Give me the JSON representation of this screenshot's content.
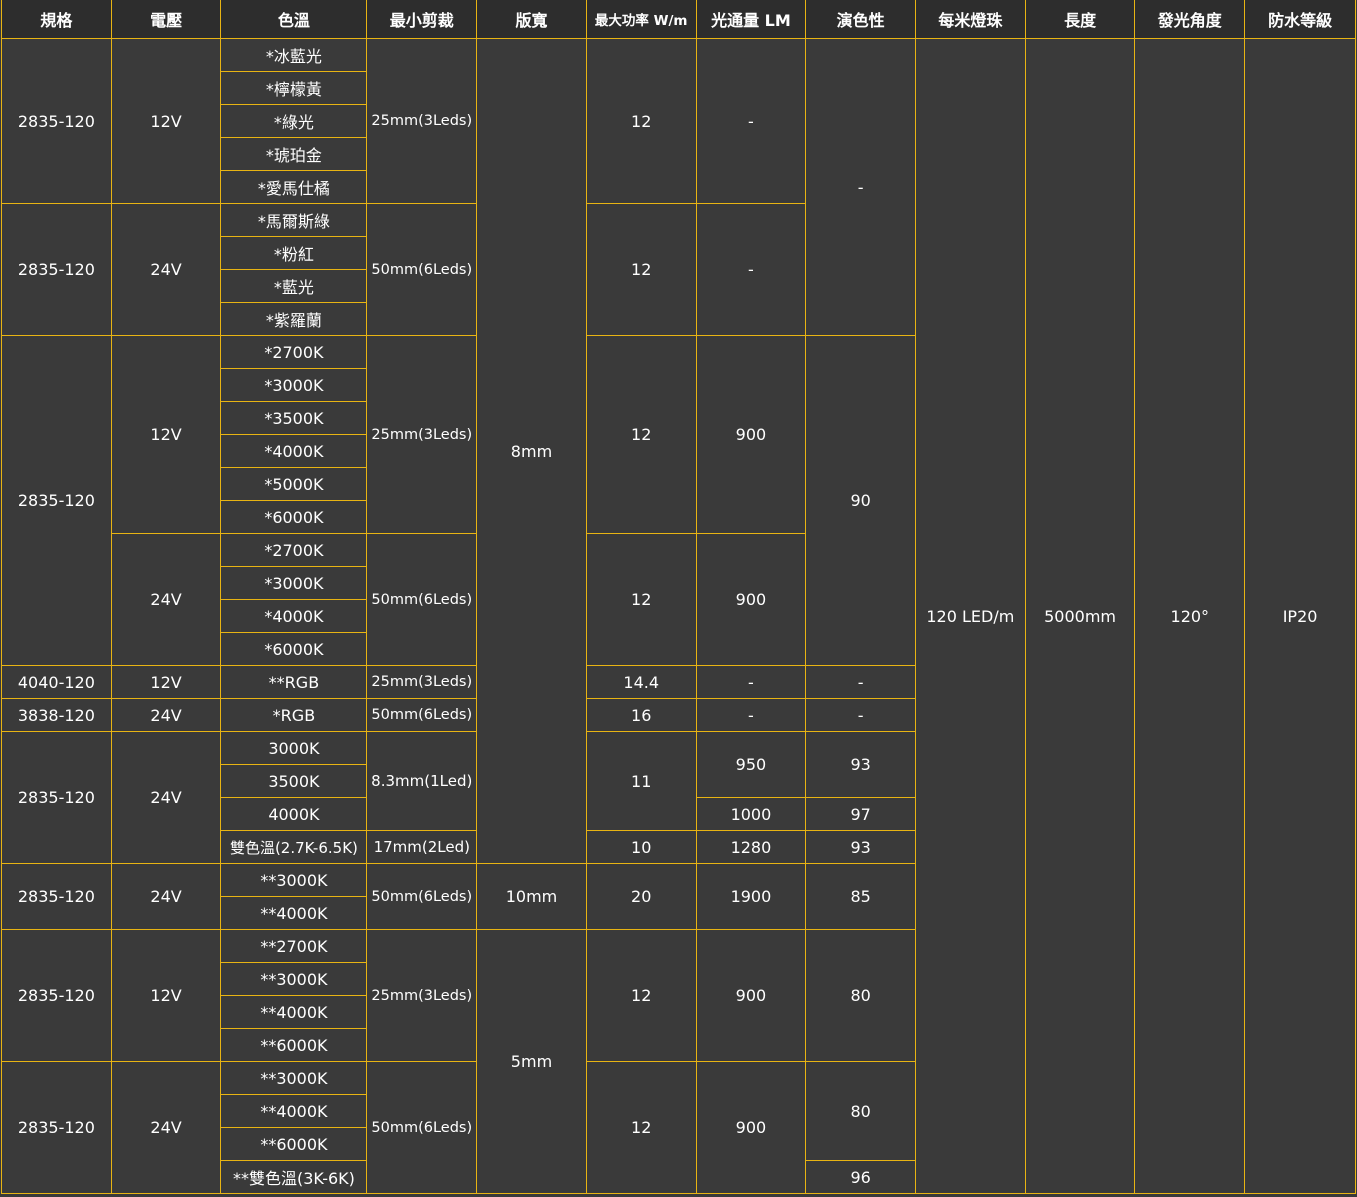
{
  "headers": {
    "spec": "規格",
    "voltage": "電壓",
    "color_temp": "色溫",
    "min_cut": "最小剪裁",
    "board_width": "版寬",
    "max_power": "最大功率 W/m",
    "luminous_flux": "光通量 LM",
    "cri": "演色性",
    "leds_per_meter": "每米燈珠",
    "length": "長度",
    "beam_angle": "發光角度",
    "ip_rating": "防水等級"
  },
  "shared": {
    "leds_per_meter": "120 LED/m",
    "length": "5000mm",
    "beam_angle": "120°",
    "ip_rating": "IP20"
  },
  "groups": {
    "g1": {
      "spec": "2835-120",
      "voltage": "12V",
      "min_cut": "25mm(3Leds)",
      "power": "12",
      "lm": "-",
      "colors": [
        "*冰藍光",
        "*檸檬黃",
        "*綠光",
        "*琥珀金",
        "*愛馬仕橘"
      ]
    },
    "g2": {
      "spec": "2835-120",
      "voltage": "24V",
      "min_cut": "50mm(6Leds)",
      "power": "12",
      "lm": "-",
      "colors": [
        "*馬爾斯綠",
        "*粉紅",
        "*藍光",
        "*紫羅蘭"
      ]
    },
    "cri_g12": "-",
    "g3": {
      "spec": "2835-120",
      "cri": "90",
      "a": {
        "voltage": "12V",
        "min_cut": "25mm(3Leds)",
        "power": "12",
        "lm": "900",
        "colors": [
          "*2700K",
          "*3000K",
          "*3500K",
          "*4000K",
          "*5000K",
          "*6000K"
        ]
      },
      "b": {
        "voltage": "24V",
        "min_cut": "50mm(6Leds)",
        "power": "12",
        "lm": "900",
        "colors": [
          "*2700K",
          "*3000K",
          "*4000K",
          "*6000K"
        ]
      }
    },
    "g4": {
      "spec": "4040-120",
      "voltage": "12V",
      "color": "**RGB",
      "min_cut": "25mm(3Leds)",
      "power": "14.4",
      "lm": "-",
      "cri": "-"
    },
    "g5": {
      "spec": "3838-120",
      "voltage": "24V",
      "color": "*RGB",
      "min_cut": "50mm(6Leds)",
      "power": "16",
      "lm": "-",
      "cri": "-"
    },
    "board_8mm": "8mm",
    "g6": {
      "spec": "2835-120",
      "voltage": "24V",
      "colors": [
        "3000K",
        "3500K",
        "4000K",
        "雙色溫(2.7K-6.5K)"
      ],
      "min_cut_a": "8.3mm(1Led)",
      "min_cut_b": "17mm(2Led)",
      "power_a": "11",
      "power_b": "10",
      "lm": [
        "950",
        "1000",
        "1280"
      ],
      "cri": [
        "93",
        "97",
        "93"
      ]
    },
    "g7": {
      "spec": "2835-120",
      "voltage": "24V",
      "colors": [
        "**3000K",
        "**4000K"
      ],
      "min_cut": "50mm(6Leds)",
      "board": "10mm",
      "power": "20",
      "lm": "1900",
      "cri": "85"
    },
    "g8": {
      "spec": "2835-120",
      "voltage": "12V",
      "colors": [
        "**2700K",
        "**3000K",
        "**4000K",
        "**6000K"
      ],
      "min_cut": "25mm(3Leds)",
      "power": "12",
      "lm": "900",
      "cri": "80"
    },
    "board_5mm": "5mm",
    "g9": {
      "spec": "2835-120",
      "voltage": "24V",
      "colors": [
        "**3000K",
        "**4000K",
        "**6000K",
        "**雙色溫(3K-6K)"
      ],
      "min_cut": "50mm(6Leds)",
      "power": "12",
      "lm": "900",
      "cri": [
        "80",
        "96"
      ]
    }
  }
}
